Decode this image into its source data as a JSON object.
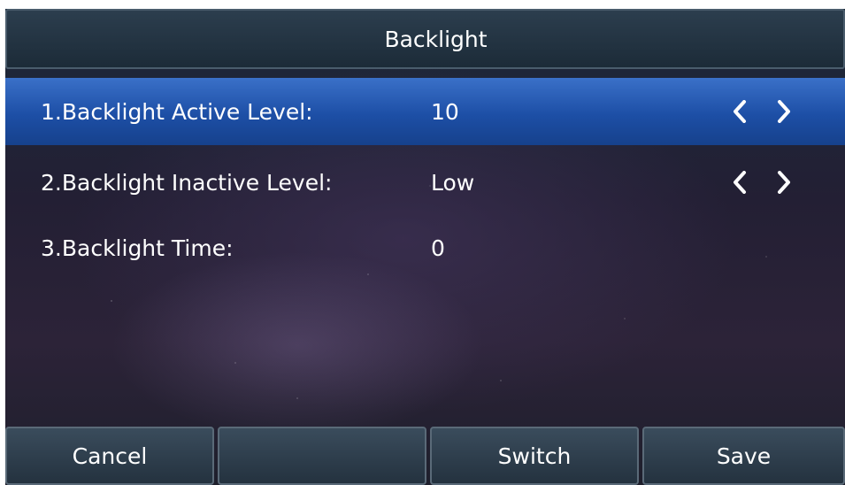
{
  "header": {
    "title": "Backlight"
  },
  "menu": {
    "items": [
      {
        "label": "1.Backlight Active Level:",
        "value": "10",
        "selected": true,
        "has_arrows": true
      },
      {
        "label": "2.Backlight Inactive Level:",
        "value": "Low",
        "selected": false,
        "has_arrows": true
      },
      {
        "label": "3.Backlight Time:",
        "value": "0",
        "selected": false,
        "has_arrows": false
      }
    ]
  },
  "softkeys": [
    {
      "label": "Cancel"
    },
    {
      "label": ""
    },
    {
      "label": "Switch"
    },
    {
      "label": "Save"
    }
  ],
  "icons": {
    "left": "chevron-left-icon",
    "right": "chevron-right-icon"
  },
  "colors": {
    "selected_row": "#1d4fa6",
    "text": "#ffffff"
  }
}
